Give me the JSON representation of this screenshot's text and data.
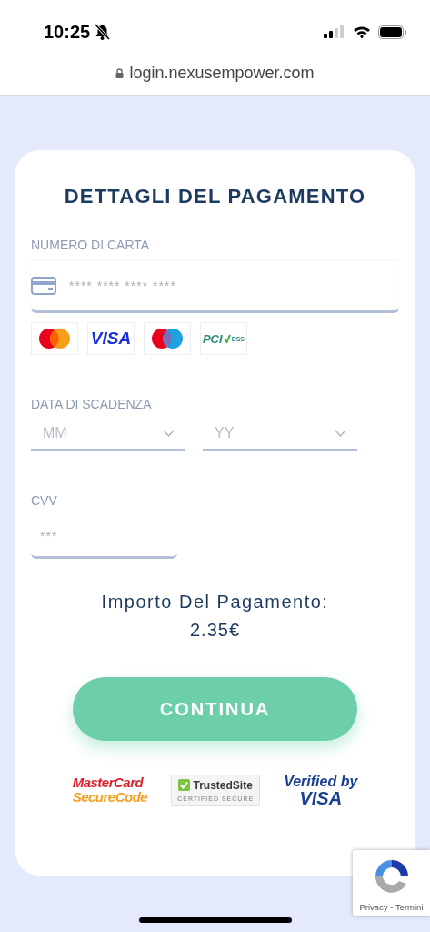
{
  "status_bar": {
    "time": "10:25",
    "silent": true
  },
  "address_bar": {
    "url": "login.nexusempower.com",
    "secure": true
  },
  "form": {
    "title": "DETTAGLI DEL PAGAMENTO",
    "card_number": {
      "label": "NUMERO DI CARTA",
      "placeholder": "**** **** **** ****"
    },
    "card_brands": [
      {
        "kind": "mastercard"
      },
      {
        "kind": "visa",
        "text": "VISA"
      },
      {
        "kind": "maestro"
      },
      {
        "kind": "pci",
        "text": "PCI",
        "subtext": "DSS"
      }
    ],
    "expiry": {
      "label": "DATA DI SCADENZA",
      "month": {
        "placeholder": "MM"
      },
      "year": {
        "placeholder": "YY"
      }
    },
    "cvv": {
      "label": "CVV",
      "placeholder": "***"
    },
    "amount": {
      "label": "Importo Del Pagamento:",
      "value": "2.35€"
    },
    "submit": "CONTINUA",
    "trust_badges": [
      {
        "kind": "mastercard_securecode",
        "line1": "MasterCard",
        "line2": "SecureCode"
      },
      {
        "kind": "trustedsite",
        "line1": "TrustedSite",
        "line2": "CERTIFIED SECURE"
      },
      {
        "kind": "verified_by_visa",
        "line1": "Verified by",
        "line2": "VISA"
      }
    ]
  },
  "recaptcha": {
    "links": "Privacy - Termini"
  }
}
